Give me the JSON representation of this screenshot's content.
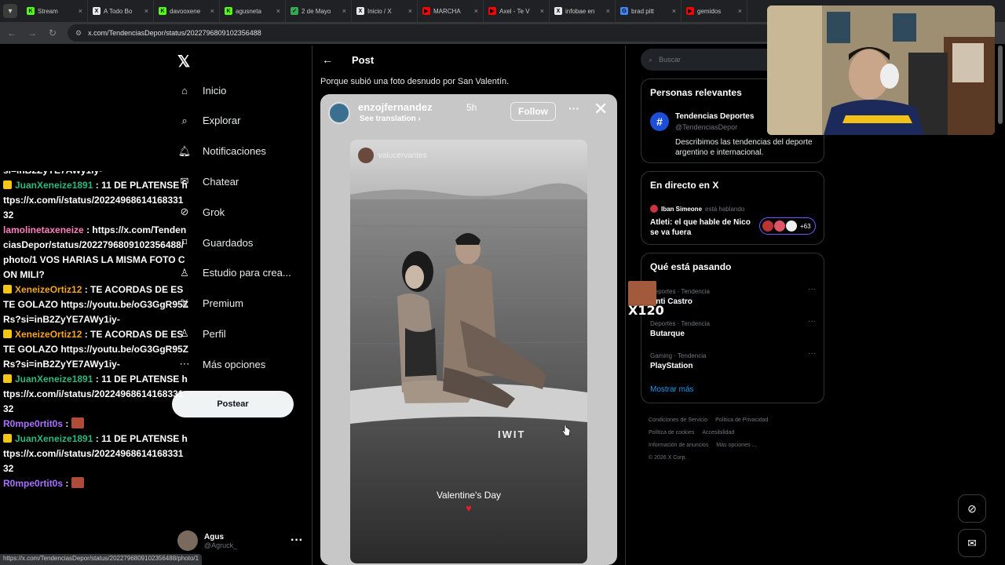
{
  "browser": {
    "tabs": [
      {
        "label": "Stream",
        "fav_color": "#53fc18",
        "fav_text": "K"
      },
      {
        "label": "A Todo Bo",
        "fav_color": "#e7e9ea",
        "fav_text": "X"
      },
      {
        "label": "davooxene",
        "fav_color": "#53fc18",
        "fav_text": "K"
      },
      {
        "label": "agusneta",
        "fav_color": "#53fc18",
        "fav_text": "K"
      },
      {
        "label": "2 de Mayo",
        "fav_color": "#34a853",
        "fav_text": "✓"
      },
      {
        "label": "Inicio / X",
        "fav_color": "#e7e9ea",
        "fav_text": "X"
      },
      {
        "label": "MARCHA",
        "fav_color": "#ff0000",
        "fav_text": "▶"
      },
      {
        "label": "Axel - Te V",
        "fav_color": "#ff0000",
        "fav_text": "▶"
      },
      {
        "label": "infobae en",
        "fav_color": "#e7e9ea",
        "fav_text": "X"
      },
      {
        "label": "brad pitt",
        "fav_color": "#4285f4",
        "fav_text": "G"
      },
      {
        "label": "gemidos",
        "fav_color": "#ff0000",
        "fav_text": "▶"
      }
    ],
    "url": "x.com/TendenciasDepor/status/2022796809102356488",
    "status_url": "https://x.com/TendenciasDepor/status/2022796809102356488/photo/1"
  },
  "nav": {
    "items": [
      {
        "label": "Inicio",
        "icon": "home-icon"
      },
      {
        "label": "Explorar",
        "icon": "search-icon"
      },
      {
        "label": "Notificaciones",
        "icon": "bell-icon"
      },
      {
        "label": "Chatear",
        "icon": "mail-icon"
      },
      {
        "label": "Grok",
        "icon": "grok-icon"
      },
      {
        "label": "Guardados",
        "icon": "bookmark-icon"
      },
      {
        "label": "Estudio para crea...",
        "icon": "studio-icon"
      },
      {
        "label": "Premium",
        "icon": "x-premium-icon"
      },
      {
        "label": "Perfil",
        "icon": "person-icon"
      },
      {
        "label": "Más opciones",
        "icon": "more-circle-icon"
      }
    ],
    "post_button": "Postear",
    "profile": {
      "name": "Agus",
      "handle": "@Agruck_"
    }
  },
  "chat": {
    "top_partial": "si=inB2ZyYE7AWy1iy-",
    "messages": [
      {
        "user": "JuanXeneize1891",
        "color": "#2fb87e",
        "text": ": 11 DE PLATENSE https://x.com/i/status/2022496861416833132",
        "badge": true
      },
      {
        "user": "lamolinetaxeneize",
        "color": "#ff7fbf",
        "text": ": https://x.com/TendenciasDepor/status/2022796809102356488/photo/1 VOS HARIAS LA MISMA FOTO CON MILI?",
        "badge": false
      },
      {
        "user": "XeneizeOrtiz12",
        "color": "#f5a623",
        "text": ": TE ACORDAS DE ESTE GOLAZO https://youtu.be/oG3GgR95ZRs?si=inB2ZyYE7AWy1iy-",
        "badge": true
      },
      {
        "user": "XeneizeOrtiz12",
        "color": "#f5a623",
        "text": ": TE ACORDAS DE ESTE GOLAZO https://youtu.be/oG3GgR95ZRs?si=inB2ZyYE7AWy1iy-",
        "badge": true
      },
      {
        "user": "JuanXeneize1891",
        "color": "#2fb87e",
        "text": ": 11 DE PLATENSE https://x.com/i/status/2022496861416833132",
        "badge": true
      },
      {
        "user": "R0mpe0rtit0s",
        "color": "#a970ff",
        "text": ":",
        "badge": false,
        "emote": true
      },
      {
        "user": "JuanXeneize1891",
        "color": "#2fb87e",
        "text": ": 11 DE PLATENSE https://x.com/i/status/2022496861416833132",
        "badge": true
      },
      {
        "user": "R0mpe0rtit0s",
        "color": "#a970ff",
        "text": ":",
        "badge": false,
        "emote": true
      }
    ]
  },
  "post": {
    "header": "Post",
    "text": "Porque subió una foto desnudo por San Valentín.",
    "story": {
      "username": "enzojfernandez",
      "time": "5h",
      "see_translation": "See translation",
      "follow": "Follow",
      "inner_username": "valucervantes",
      "caption": "Valentine's Day",
      "board_text": "IWIT"
    }
  },
  "sidebar": {
    "search_placeholder": "Buscar",
    "relevant": {
      "title": "Personas relevantes",
      "name": "Tendencias Deportes",
      "handle": "@TendenciasDepor",
      "bio": "Describimos las tendencias del deporte argentino e internacional."
    },
    "live": {
      "title": "En directo en X",
      "host": "Iban Simeone",
      "status": "está hablando",
      "space_title": "Atleti: el que hable de Nico se va fuera",
      "listeners": "+63"
    },
    "trending": {
      "title": "Qué está pasando",
      "items": [
        {
          "category": "Deportes · Tendencia",
          "name": "Anti Castro"
        },
        {
          "category": "Deportes · Tendencia",
          "name": "Butarque"
        },
        {
          "category": "Gaming · Tendencia",
          "name": "PlayStation"
        }
      ],
      "show_more": "Mostrar más"
    },
    "footer": [
      "Condiciones de Servicio",
      "Política de Privacidad",
      "Política de cookies",
      "Accesibilidad",
      "Información de anuncios",
      "Más opciones ...",
      "© 2026 X Corp."
    ]
  },
  "overlay": {
    "emote_label": "X120"
  }
}
